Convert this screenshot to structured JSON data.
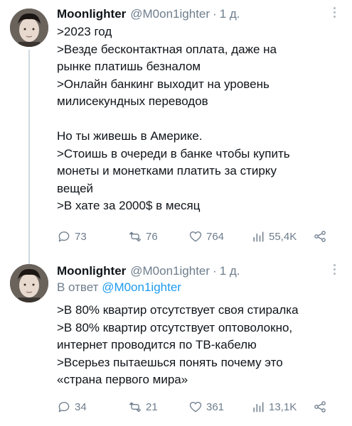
{
  "tweets": [
    {
      "author": "Moonlighter",
      "handle": "@M0on1ighter",
      "separator": "·",
      "time": "1 д.",
      "lines": [
        ">2023 год",
        ">Везде бесконтактная оплата, даже на",
        "рынке платишь безналом",
        ">Онлайн банкинг выходит на уровень",
        "милисекундных переводов",
        "",
        "Но ты живешь в Америке.",
        ">Стоишь в очереди в банке чтобы купить",
        "монеты и монетками платить за стирку",
        "вещей",
        ">В хате за 2000$ в месяц"
      ],
      "stats": {
        "replies": "73",
        "retweets": "76",
        "likes": "764",
        "views": "55,4K"
      }
    },
    {
      "author": "Moonlighter",
      "handle": "@M0on1ighter",
      "separator": "·",
      "time": "1 д.",
      "reply_prefix": "В ответ",
      "reply_mention": "@M0on1ighter",
      "lines": [
        ">В 80% квартир отсутствует своя стиралка",
        ">В 80% квартир отсутствует оптоволокно,",
        "интернет проводится по ТВ-кабелю",
        ">Всерьез пытаешься понять почему это",
        "«страна первого мира»"
      ],
      "stats": {
        "replies": "34",
        "retweets": "21",
        "likes": "361",
        "views": "13,1K"
      }
    }
  ],
  "icons": {
    "reply": "speech-bubble-icon",
    "retweet": "retweet-icon",
    "like": "heart-icon",
    "views": "bar-chart-icon",
    "share": "share-icon",
    "more": "more-dots-icon"
  },
  "colors": {
    "text": "#0f1419",
    "muted": "#6e7d8c",
    "link": "#1d9bf0",
    "thread_line": "#cfd9de"
  }
}
